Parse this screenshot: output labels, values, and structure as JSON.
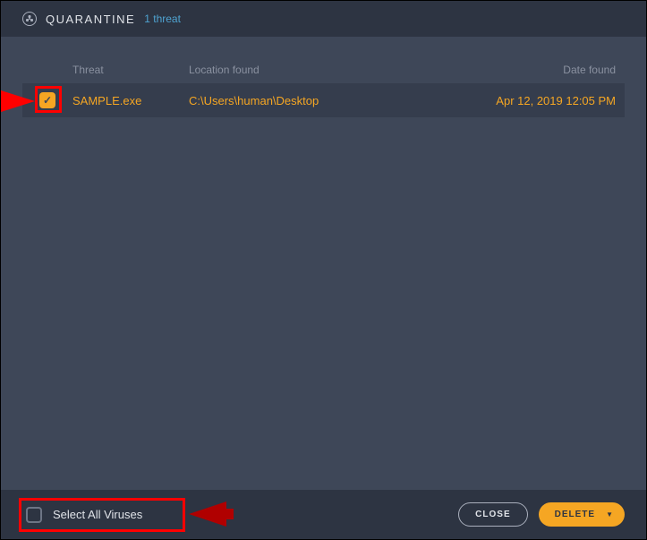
{
  "header": {
    "title": "QUARANTINE",
    "threat_count": "1 threat"
  },
  "table": {
    "columns": {
      "threat": "Threat",
      "location": "Location found",
      "date": "Date found"
    },
    "rows": [
      {
        "checked": true,
        "threat": "SAMPLE.exe",
        "location": "C:\\Users\\human\\Desktop",
        "date": "Apr 12, 2019 12:05 PM"
      }
    ]
  },
  "footer": {
    "select_all": "Select All Viruses",
    "close": "CLOSE",
    "delete": "DELETE"
  }
}
